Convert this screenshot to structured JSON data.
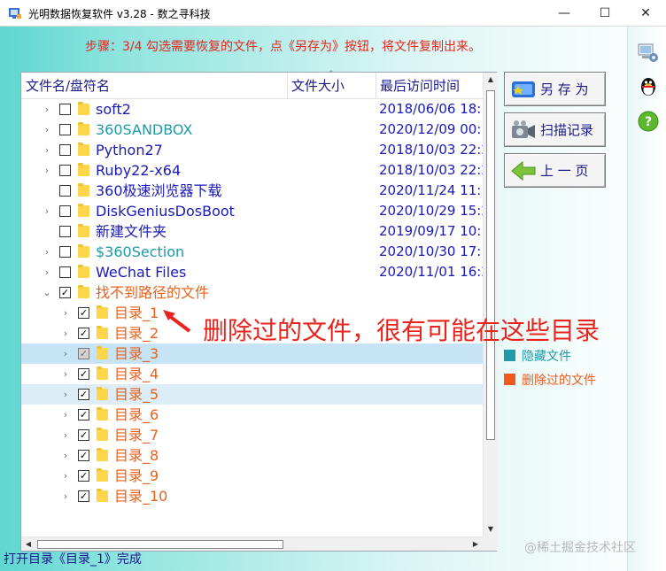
{
  "window": {
    "title": "光明数据恢复软件 v3.28 - 数之寻科技",
    "minimize": "—",
    "maximize": "☐",
    "close": "✕"
  },
  "step_text": "步骤：3/4 勾选需要恢复的文件，点《另存为》按钮，将文件复制出来。",
  "columns": {
    "name": "文件名/盘符名",
    "size": "文件大小",
    "time": "最后访问时间"
  },
  "rows": [
    {
      "name": "soft2",
      "date": "2018/06/06 18:",
      "color": "#1a1ab8",
      "checked": false,
      "expand": "›",
      "level": 0
    },
    {
      "name": "360SANDBOX",
      "date": "2020/12/09 00:",
      "color": "#1f9aa6",
      "checked": false,
      "expand": "›",
      "level": 0
    },
    {
      "name": "Python27",
      "date": "2018/10/03 22:2",
      "color": "#1a1ab8",
      "checked": false,
      "expand": "›",
      "level": 0
    },
    {
      "name": "Ruby22-x64",
      "date": "2018/10/03 22:2",
      "color": "#1a1ab8",
      "checked": false,
      "expand": "›",
      "level": 0
    },
    {
      "name": "360极速浏览器下载",
      "date": "2020/11/24 11:",
      "color": "#1a1ab8",
      "checked": false,
      "expand": "",
      "level": 0
    },
    {
      "name": "DiskGeniusDosBoot",
      "date": "2020/10/29 15:2",
      "color": "#1a1ab8",
      "checked": false,
      "expand": "›",
      "level": 0
    },
    {
      "name": "新建文件夹",
      "date": "2019/09/17 10:",
      "color": "#1a1ab8",
      "checked": false,
      "expand": "",
      "level": 0
    },
    {
      "name": "$360Section",
      "date": "2020/10/30 17:",
      "color": "#1f9aa6",
      "checked": false,
      "expand": "›",
      "level": 0
    },
    {
      "name": "WeChat Files",
      "date": "2020/11/01 16:2",
      "color": "#1a1ab8",
      "checked": false,
      "expand": "›",
      "level": 0
    },
    {
      "name": "找不到路径的文件",
      "date": "",
      "color": "#e8601c",
      "checked": true,
      "expand": "⌄",
      "level": 0
    },
    {
      "name": "目录_1",
      "date": "",
      "color": "#e8601c",
      "checked": true,
      "expand": "›",
      "level": 1
    },
    {
      "name": "目录_2",
      "date": "",
      "color": "#e8601c",
      "checked": true,
      "expand": "›",
      "level": 1
    },
    {
      "name": "目录_3",
      "date": "",
      "color": "#e8601c",
      "checked": true,
      "expand": "›",
      "level": 1,
      "highlight": "hl1",
      "gray": true
    },
    {
      "name": "目录_4",
      "date": "",
      "color": "#e8601c",
      "checked": true,
      "expand": "›",
      "level": 1
    },
    {
      "name": "目录_5",
      "date": "",
      "color": "#e8601c",
      "checked": true,
      "expand": "›",
      "level": 1,
      "highlight": "hl2"
    },
    {
      "name": "目录_6",
      "date": "",
      "color": "#e8601c",
      "checked": true,
      "expand": "›",
      "level": 1
    },
    {
      "name": "目录_7",
      "date": "",
      "color": "#e8601c",
      "checked": true,
      "expand": "›",
      "level": 1
    },
    {
      "name": "目录_8",
      "date": "",
      "color": "#e8601c",
      "checked": true,
      "expand": "›",
      "level": 1
    },
    {
      "name": "目录_9",
      "date": "",
      "color": "#e8601c",
      "checked": true,
      "expand": "›",
      "level": 1
    },
    {
      "name": "目录_10",
      "date": "",
      "color": "#e8601c",
      "checked": true,
      "expand": "›",
      "level": 1
    }
  ],
  "buttons": {
    "save_as": "另 存 为",
    "scan_record": "扫描记录",
    "prev_page": "上 一 页"
  },
  "legend": [
    {
      "label": "隐藏文件",
      "color": "#1f9aa6"
    },
    {
      "label": "删除过的文件",
      "color": "#f05a1c"
    }
  ],
  "annotation": "删除过的文件，很有可能在这些目录",
  "status": "打开目录《目录_1》完成",
  "watermark": "@稀土掘金技术社区",
  "icons": {
    "app": "app-icon",
    "save": "save-icon",
    "scan": "camera-icon",
    "prev": "back-arrow-icon",
    "settings": "computer-settings-icon",
    "qq": "qq-penguin-icon",
    "help": "help-icon"
  },
  "colors": {
    "accent_red": "#e8241c",
    "link_blue": "#1a1ab8",
    "teal": "#1f9aa6",
    "deleted_orange": "#e8601c"
  }
}
